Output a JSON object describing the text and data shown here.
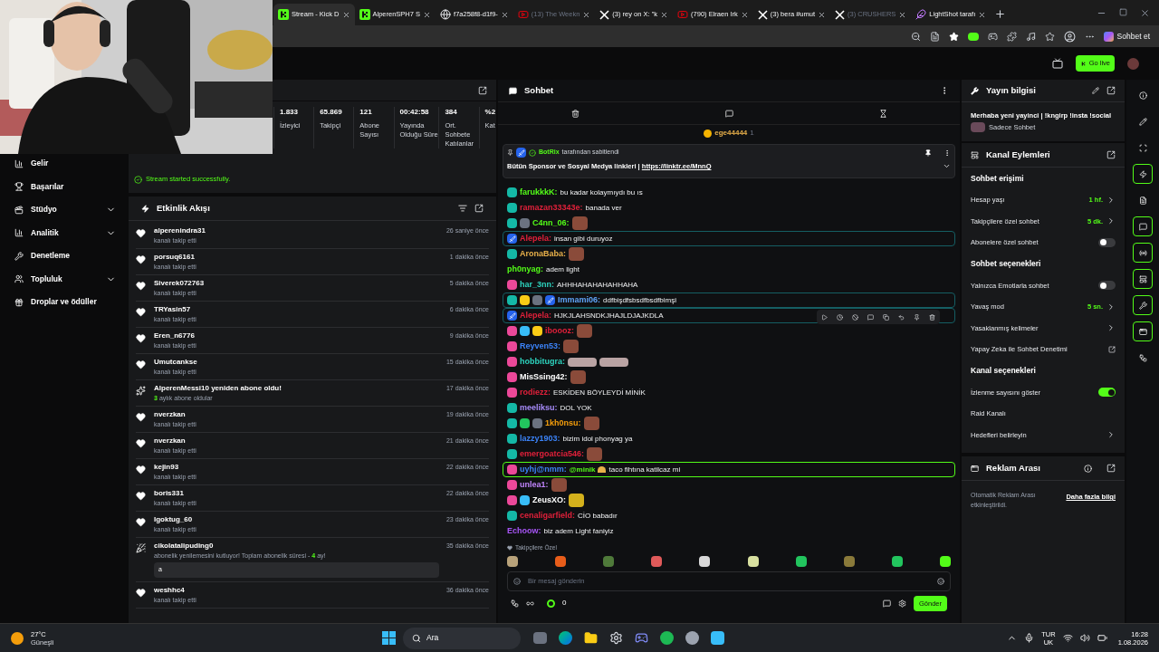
{
  "browser": {
    "tabs": [
      {
        "title": "Stream - Kick D",
        "kind": "kick",
        "selected": true,
        "dimmed": false
      },
      {
        "title": "AlperenSPH7 S",
        "kind": "kick",
        "selected": false,
        "dimmed": false
      },
      {
        "title": "f7a258f8-d1f9-",
        "kind": "globe",
        "selected": false,
        "dimmed": false
      },
      {
        "title": "(13) The Weekn",
        "kind": "youtube",
        "selected": false,
        "dimmed": true
      },
      {
        "title": "(3) rey on X: \"k",
        "kind": "x",
        "selected": false,
        "dimmed": false
      },
      {
        "title": "(790) Elraen Irk",
        "kind": "youtube",
        "selected": false,
        "dimmed": false
      },
      {
        "title": "(3) bera #umut",
        "kind": "x",
        "selected": false,
        "dimmed": false
      },
      {
        "title": "(3) CRUSHERS",
        "kind": "x",
        "selected": false,
        "dimmed": true
      },
      {
        "title": "LightShot tarafı",
        "kind": "feather",
        "selected": false,
        "dimmed": false
      }
    ],
    "copilot_label": "Sohbet et"
  },
  "header": {
    "go_live": "Go live"
  },
  "sidebar": {
    "items": [
      {
        "label": "Gelir",
        "kind": "chart",
        "expandable": false
      },
      {
        "label": "Başarılar",
        "kind": "trophy",
        "expandable": false
      },
      {
        "label": "Stüdyo",
        "kind": "film",
        "expandable": true
      },
      {
        "label": "Analitik",
        "kind": "analytics",
        "expandable": true
      },
      {
        "label": "Denetleme",
        "kind": "wrench",
        "expandable": false
      },
      {
        "label": "Topluluk",
        "kind": "users",
        "expandable": true
      },
      {
        "label": "Droplar ve ödüller",
        "kind": "gift",
        "expandable": false
      }
    ]
  },
  "stats": [
    {
      "value": "1.833",
      "label": "İzleyici"
    },
    {
      "value": "65.869",
      "label": "Takipçi"
    },
    {
      "value": "121",
      "label": "Abone Sayısı"
    },
    {
      "value": "00:42:58",
      "label": "Yayında Olduğu Süre"
    },
    {
      "value": "384",
      "label": "Ort. Sohbete Katılanlar"
    },
    {
      "value": "%2",
      "label": "Kat"
    }
  ],
  "status_message": "Stream started successfully.",
  "activity": {
    "title": "Etkinlik Akışı",
    "items": [
      {
        "kind": "follow",
        "user": "alperenindra31",
        "detail": "kanalı takip etti",
        "time": "26 saniye önce"
      },
      {
        "kind": "follow",
        "user": "porsuq6161",
        "detail": "kanalı takip etti",
        "time": "1 dakika önce"
      },
      {
        "kind": "follow",
        "user": "Siverek072763",
        "detail": "kanalı takip etti",
        "time": "5 dakika önce"
      },
      {
        "kind": "follow",
        "user": "TRYasin57",
        "detail": "kanalı takip etti",
        "time": "6 dakika önce"
      },
      {
        "kind": "follow",
        "user": "Eren_n6776",
        "detail": "kanalı takip etti",
        "time": "9 dakika önce"
      },
      {
        "kind": "follow",
        "user": "Umutcankse",
        "detail": "kanalı takip etti",
        "time": "15 dakika önce"
      },
      {
        "kind": "resub",
        "user": "AlperenMessi10 yeniden abone oldu!",
        "count": "3",
        "detail": "aylık abone oldular",
        "time": "17 dakika önce"
      },
      {
        "kind": "follow",
        "user": "nverzkan",
        "detail": "kanalı takip etti",
        "time": "19 dakika önce"
      },
      {
        "kind": "follow",
        "user": "nverzkan",
        "detail": "kanalı takip etti",
        "time": "21 dakika önce"
      },
      {
        "kind": "follow",
        "user": "kejin93",
        "detail": "kanalı takip etti",
        "time": "22 dakika önce"
      },
      {
        "kind": "follow",
        "user": "boris331",
        "detail": "kanalı takip etti",
        "time": "22 dakika önce"
      },
      {
        "kind": "follow",
        "user": "lgoktug_60",
        "detail": "kanalı takip etti",
        "time": "23 dakika önce"
      },
      {
        "kind": "renewal",
        "user": "cikolatalipuding0",
        "detail": "abonelik yenilemesini kutluyor! Toplam abonelik süresi -",
        "count": "4",
        "detail_after": "ay!",
        "message": "a",
        "time": "35 dakika önce"
      },
      {
        "kind": "follow",
        "user": "weshhc4",
        "detail": "kanalı takip etti",
        "time": "36 dakika önce"
      }
    ]
  },
  "chat": {
    "title": "Sohbet",
    "gift_leader": {
      "user": "ege44444",
      "count": "1"
    },
    "pinned": {
      "author": "BotRix",
      "note": "tarafından sabitlendi",
      "text": "Bütün Sponsor ve Sosyal Medya linkleri | ",
      "link": "https://linktr.ee/MnnQ"
    },
    "messages": [
      {
        "kind": "normal",
        "badges": [
          {
            "kind": "sub"
          }
        ],
        "user": "farukkkK:",
        "color": "#53fc18",
        "text": "bu kadar kolaymıydı bu ıs"
      },
      {
        "kind": "normal",
        "badges": [
          {
            "kind": "sub"
          }
        ],
        "user": "ramazan33343e:",
        "color": "#e0203a",
        "text": "banada ver"
      },
      {
        "kind": "normal",
        "badges": [
          {
            "kind": "sub"
          },
          {
            "kind": "gray"
          }
        ],
        "user": "C4nn_06:",
        "color": "#53fc18",
        "emotes": [
          {
            "kind": "square"
          }
        ]
      },
      {
        "kind": "moderator",
        "badges": [
          {
            "kind": "mod"
          }
        ],
        "user": "Alepela:",
        "color": "#e0203a",
        "text": "insan gibi duruyoz"
      },
      {
        "kind": "normal",
        "badges": [
          {
            "kind": "sub"
          }
        ],
        "user": "AronaBaba:",
        "color": "#e8b04a",
        "emotes": [
          {
            "kind": "square"
          }
        ]
      },
      {
        "kind": "normal",
        "user": "ph0nyag:",
        "color": "#53fc18",
        "text": "adem light"
      },
      {
        "kind": "normal",
        "badges": [
          {
            "kind": "pink"
          }
        ],
        "user": "har_3nn:",
        "color": "#2dd4bf",
        "text": "AHHHAHAHAHAHHAHA"
      },
      {
        "kind": "moderator",
        "badges": [
          {
            "kind": "sub"
          },
          {
            "kind": "k"
          },
          {
            "kind": "gray"
          },
          {
            "kind": "mod"
          }
        ],
        "user": "Immami06:",
        "color": "#60a5fa",
        "text": "ddfbişdfsbsdfbsdfbimşi"
      },
      {
        "kind": "moderator",
        "badges": [
          {
            "kind": "mod"
          }
        ],
        "user": "Alepela:",
        "color": "#e0203a",
        "text": "HJKJLAHSNDKJHAJLDJAJKDLA"
      },
      {
        "kind": "normal",
        "badges": [
          {
            "kind": "pink"
          },
          {
            "kind": "globe"
          },
          {
            "kind": "k"
          }
        ],
        "user": "iboooz:",
        "color": "#e0203a",
        "emotes": [
          {
            "kind": "square"
          }
        ]
      },
      {
        "kind": "normal",
        "badges": [
          {
            "kind": "pink"
          }
        ],
        "user": "Reyven53:",
        "color": "#3b82f6",
        "emotes": [
          {
            "kind": "square"
          }
        ]
      },
      {
        "kind": "normal",
        "badges": [
          {
            "kind": "pink"
          }
        ],
        "user": "hobbitugra:",
        "color": "#2dd4bf",
        "emotes": [
          {
            "kind": "wide"
          },
          {
            "kind": "wide"
          }
        ]
      },
      {
        "kind": "normal",
        "badges": [
          {
            "kind": "pink"
          }
        ],
        "user": "MisSsing42:",
        "color": "#ffffff",
        "emotes": [
          {
            "kind": "square"
          }
        ]
      },
      {
        "kind": "normal",
        "badges": [
          {
            "kind": "pink"
          }
        ],
        "user": "rodiezz:",
        "color": "#e0203a",
        "text": "ESKİDEN BÖYLEYDİ MİNİK"
      },
      {
        "kind": "normal",
        "badges": [
          {
            "kind": "sub"
          }
        ],
        "user": "meeliksu:",
        "color": "#a78bfa",
        "text": "DOL YOK"
      },
      {
        "kind": "normal",
        "badges": [
          {
            "kind": "sub"
          },
          {
            "kind": "gift"
          },
          {
            "kind": "gray"
          }
        ],
        "user": "1kh0nsu:",
        "color": "#f59e0b",
        "emotes": [
          {
            "kind": "square"
          }
        ]
      },
      {
        "kind": "normal",
        "badges": [
          {
            "kind": "sub"
          }
        ],
        "user": "lazzy1903:",
        "color": "#3b82f6",
        "text": "bizim idol phonyag ya"
      },
      {
        "kind": "normal",
        "badges": [
          {
            "kind": "sub"
          }
        ],
        "user": "emergoatcia546:",
        "color": "#e0203a",
        "emotes": [
          {
            "kind": "square"
          }
        ]
      },
      {
        "kind": "mention",
        "badges": [
          {
            "kind": "pink"
          }
        ],
        "user": "uyhj@nmm:",
        "color": "#3b82f6",
        "mention": "@minik",
        "text": "taco fihtına katilcaz mi"
      },
      {
        "kind": "normal",
        "badges": [
          {
            "kind": "pink"
          }
        ],
        "user": "unlea1:",
        "color": "#c084fc",
        "emotes": [
          {
            "kind": "square"
          }
        ]
      },
      {
        "kind": "normal",
        "badges": [
          {
            "kind": "pink"
          },
          {
            "kind": "globe"
          }
        ],
        "user": "ZeusXO:",
        "color": "#ffffff",
        "emotes": [
          {
            "kind": "gold"
          }
        ]
      },
      {
        "kind": "normal",
        "badges": [
          {
            "kind": "sub"
          }
        ],
        "user": "cenaligarfield:",
        "color": "#e0203a",
        "text": "CİO babadır"
      },
      {
        "kind": "normal",
        "user": "Echoow:",
        "color": "#a855f7",
        "text": "biz adem Light faniyiz"
      }
    ],
    "emote_bar_title": "Takipçilere Özel",
    "input": {
      "placeholder": "Bir mesaj gönderin"
    },
    "points": "0",
    "send": "Gönder"
  },
  "stream_info": {
    "title": "Yayın bilgisi",
    "stream_title": "Merhaba yeni yayinci | !kngirp !insta !social",
    "category": "Sadece Sohbet"
  },
  "channel_actions": {
    "title": "Kanal Eylemleri",
    "rows": [
      {
        "kind": "heading",
        "label": "Sohbet erişimi"
      },
      {
        "kind": "value",
        "label": "Hesap yaşı",
        "value": "1 hf."
      },
      {
        "kind": "value",
        "label": "Takipçilere özel sohbet",
        "value": "5 dk."
      },
      {
        "kind": "toggle",
        "label": "Abonelere özel sohbet",
        "on": false
      },
      {
        "kind": "heading",
        "label": "Sohbet seçenekleri"
      },
      {
        "kind": "toggle",
        "label": "Yalnızca Emotlarla sohbet",
        "on": false
      },
      {
        "kind": "value",
        "label": "Yavaş mod",
        "value": "5 sn."
      },
      {
        "kind": "value",
        "label": "Yasaklanmış kelimeler"
      },
      {
        "kind": "external",
        "label": "Yapay Zeka ile Sohbet Denetimi"
      },
      {
        "kind": "heading",
        "label": "Kanal seçenekleri"
      },
      {
        "kind": "toggle",
        "label": "İzlenme sayısını göster",
        "on": true
      },
      {
        "kind": "plain",
        "label": "Raid Kanalı"
      },
      {
        "kind": "value",
        "label": "Hedefleri belirleyin"
      }
    ]
  },
  "ad_break": {
    "title": "Reklam Arası",
    "text": "Otomatik Reklam Arası etkinleştirildi.",
    "link": "Daha fazla bilgi"
  },
  "rail": [
    {
      "kind": "info",
      "active": false
    },
    {
      "kind": "pencil",
      "active": false
    },
    {
      "kind": "scan",
      "active": false
    },
    {
      "kind": "zap",
      "active": true
    },
    {
      "kind": "note",
      "active": false
    },
    {
      "kind": "chat",
      "active": true
    },
    {
      "kind": "radio",
      "active": true
    },
    {
      "kind": "actions",
      "active": true
    },
    {
      "kind": "wrench",
      "active": true
    },
    {
      "kind": "window",
      "active": true
    },
    {
      "kind": "nodes",
      "active": false
    }
  ],
  "taskbar": {
    "temperature": "27°C",
    "weather": "Güneşli",
    "search": "Ara",
    "language": "TUR",
    "layout": "UK",
    "time": "16:28",
    "date": "1.08.2026"
  }
}
